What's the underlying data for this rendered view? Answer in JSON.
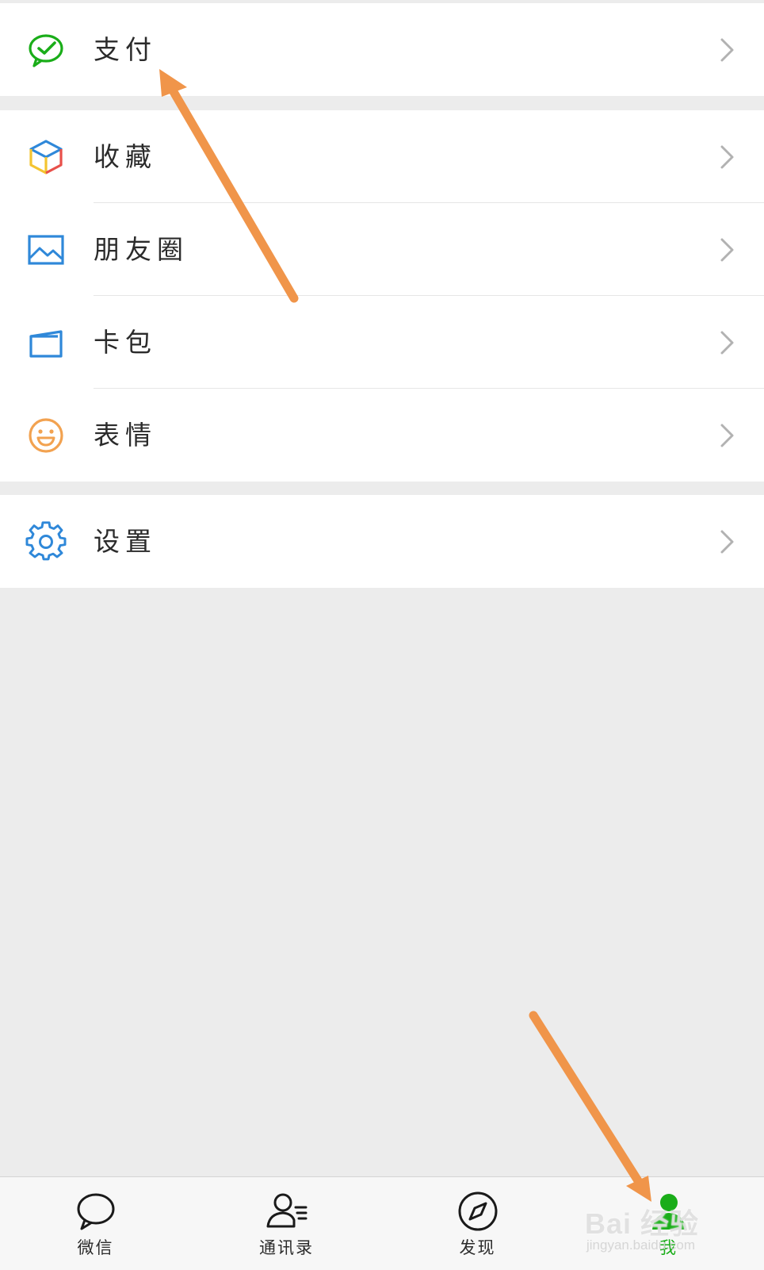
{
  "menu": {
    "payment": {
      "label": "支付",
      "icon": "wechat-pay-icon",
      "color": "#1aad19"
    },
    "favorites": {
      "label": "收藏",
      "icon": "cube-icon"
    },
    "moments": {
      "label": "朋友圈",
      "icon": "photo-album-icon",
      "color": "#2f88d9"
    },
    "cards": {
      "label": "卡包",
      "icon": "wallet-icon",
      "color": "#2f88d9"
    },
    "stickers": {
      "label": "表情",
      "icon": "smiley-icon",
      "color": "#f2a250"
    },
    "settings": {
      "label": "设置",
      "icon": "gear-icon",
      "color": "#2f88d9"
    }
  },
  "tabbar": {
    "tabs": [
      {
        "label": "微信",
        "icon": "chat-bubble-icon",
        "active": false
      },
      {
        "label": "通讯录",
        "icon": "contacts-icon",
        "active": false
      },
      {
        "label": "发现",
        "icon": "compass-icon",
        "active": false
      },
      {
        "label": "我",
        "icon": "person-icon",
        "active": true
      }
    ],
    "active_color": "#1aad19"
  },
  "annotations": {
    "arrow_color": "#f0954a"
  },
  "watermark": {
    "logo": "Bai 经验",
    "url": "jingyan.baidu.com"
  }
}
